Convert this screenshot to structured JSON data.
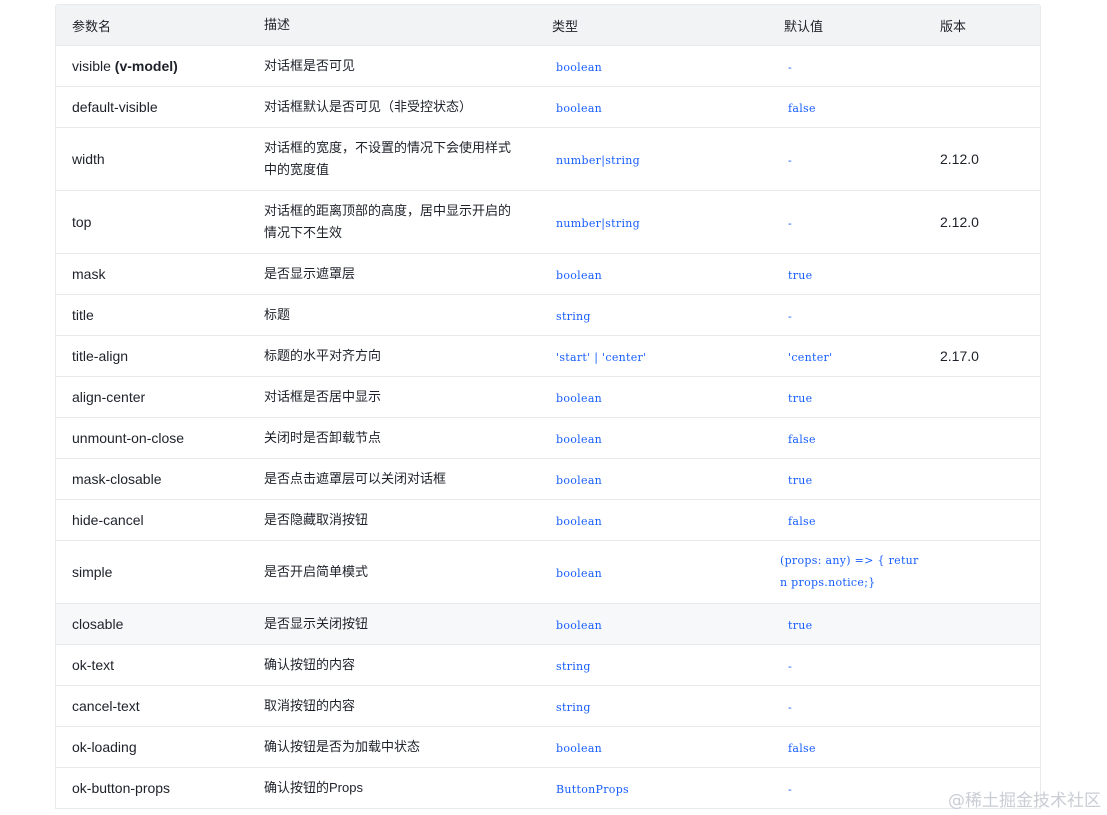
{
  "headers": {
    "name": "参数名",
    "desc": "描述",
    "type": "类型",
    "default": "默认值",
    "version": "版本"
  },
  "rows": [
    {
      "name": "visible",
      "name_sub": "(v-model)",
      "desc": "对话框是否可见",
      "type": "boolean",
      "default": "-",
      "version": ""
    },
    {
      "name": "default-visible",
      "name_sub": "",
      "desc": "对话框默认是否可见（非受控状态）",
      "type": "boolean",
      "default": "false",
      "version": ""
    },
    {
      "name": "width",
      "name_sub": "",
      "desc": "对话框的宽度，不设置的情况下会使用样式中的宽度值",
      "type": "number|string",
      "default": "-",
      "version": "2.12.0"
    },
    {
      "name": "top",
      "name_sub": "",
      "desc": "对话框的距离顶部的高度，居中显示开启的情况下不生效",
      "type": "number|string",
      "default": "-",
      "version": "2.12.0"
    },
    {
      "name": "mask",
      "name_sub": "",
      "desc": "是否显示遮罩层",
      "type": "boolean",
      "default": "true",
      "version": ""
    },
    {
      "name": "title",
      "name_sub": "",
      "desc": "标题",
      "type": "string",
      "default": "-",
      "version": ""
    },
    {
      "name": "title-align",
      "name_sub": "",
      "desc": "标题的水平对齐方向",
      "type": "'start' | 'center'",
      "default": "'center'",
      "version": "2.17.0"
    },
    {
      "name": "align-center",
      "name_sub": "",
      "desc": "对话框是否居中显示",
      "type": "boolean",
      "default": "true",
      "version": ""
    },
    {
      "name": "unmount-on-close",
      "name_sub": "",
      "desc": "关闭时是否卸载节点",
      "type": "boolean",
      "default": "false",
      "version": ""
    },
    {
      "name": "mask-closable",
      "name_sub": "",
      "desc": "是否点击遮罩层可以关闭对话框",
      "type": "boolean",
      "default": "true",
      "version": ""
    },
    {
      "name": "hide-cancel",
      "name_sub": "",
      "desc": "是否隐藏取消按钮",
      "type": "boolean",
      "default": "false",
      "version": ""
    },
    {
      "name": "simple",
      "name_sub": "",
      "desc": "是否开启简单模式",
      "type": "boolean",
      "default": "(props: any) => { return props.notice;}",
      "version": ""
    },
    {
      "name": "closable",
      "name_sub": "",
      "desc": "是否显示关闭按钮",
      "type": "boolean",
      "default": "true",
      "version": ""
    },
    {
      "name": "ok-text",
      "name_sub": "",
      "desc": "确认按钮的内容",
      "type": "string",
      "default": "-",
      "version": ""
    },
    {
      "name": "cancel-text",
      "name_sub": "",
      "desc": "取消按钮的内容",
      "type": "string",
      "default": "-",
      "version": ""
    },
    {
      "name": "ok-loading",
      "name_sub": "",
      "desc": "确认按钮是否为加载中状态",
      "type": "boolean",
      "default": "false",
      "version": ""
    },
    {
      "name": "ok-button-props",
      "name_sub": "",
      "desc": "确认按钮的Props",
      "type": "ButtonProps",
      "default": "-",
      "version": ""
    }
  ],
  "watermark": "@稀土掘金技术社区"
}
